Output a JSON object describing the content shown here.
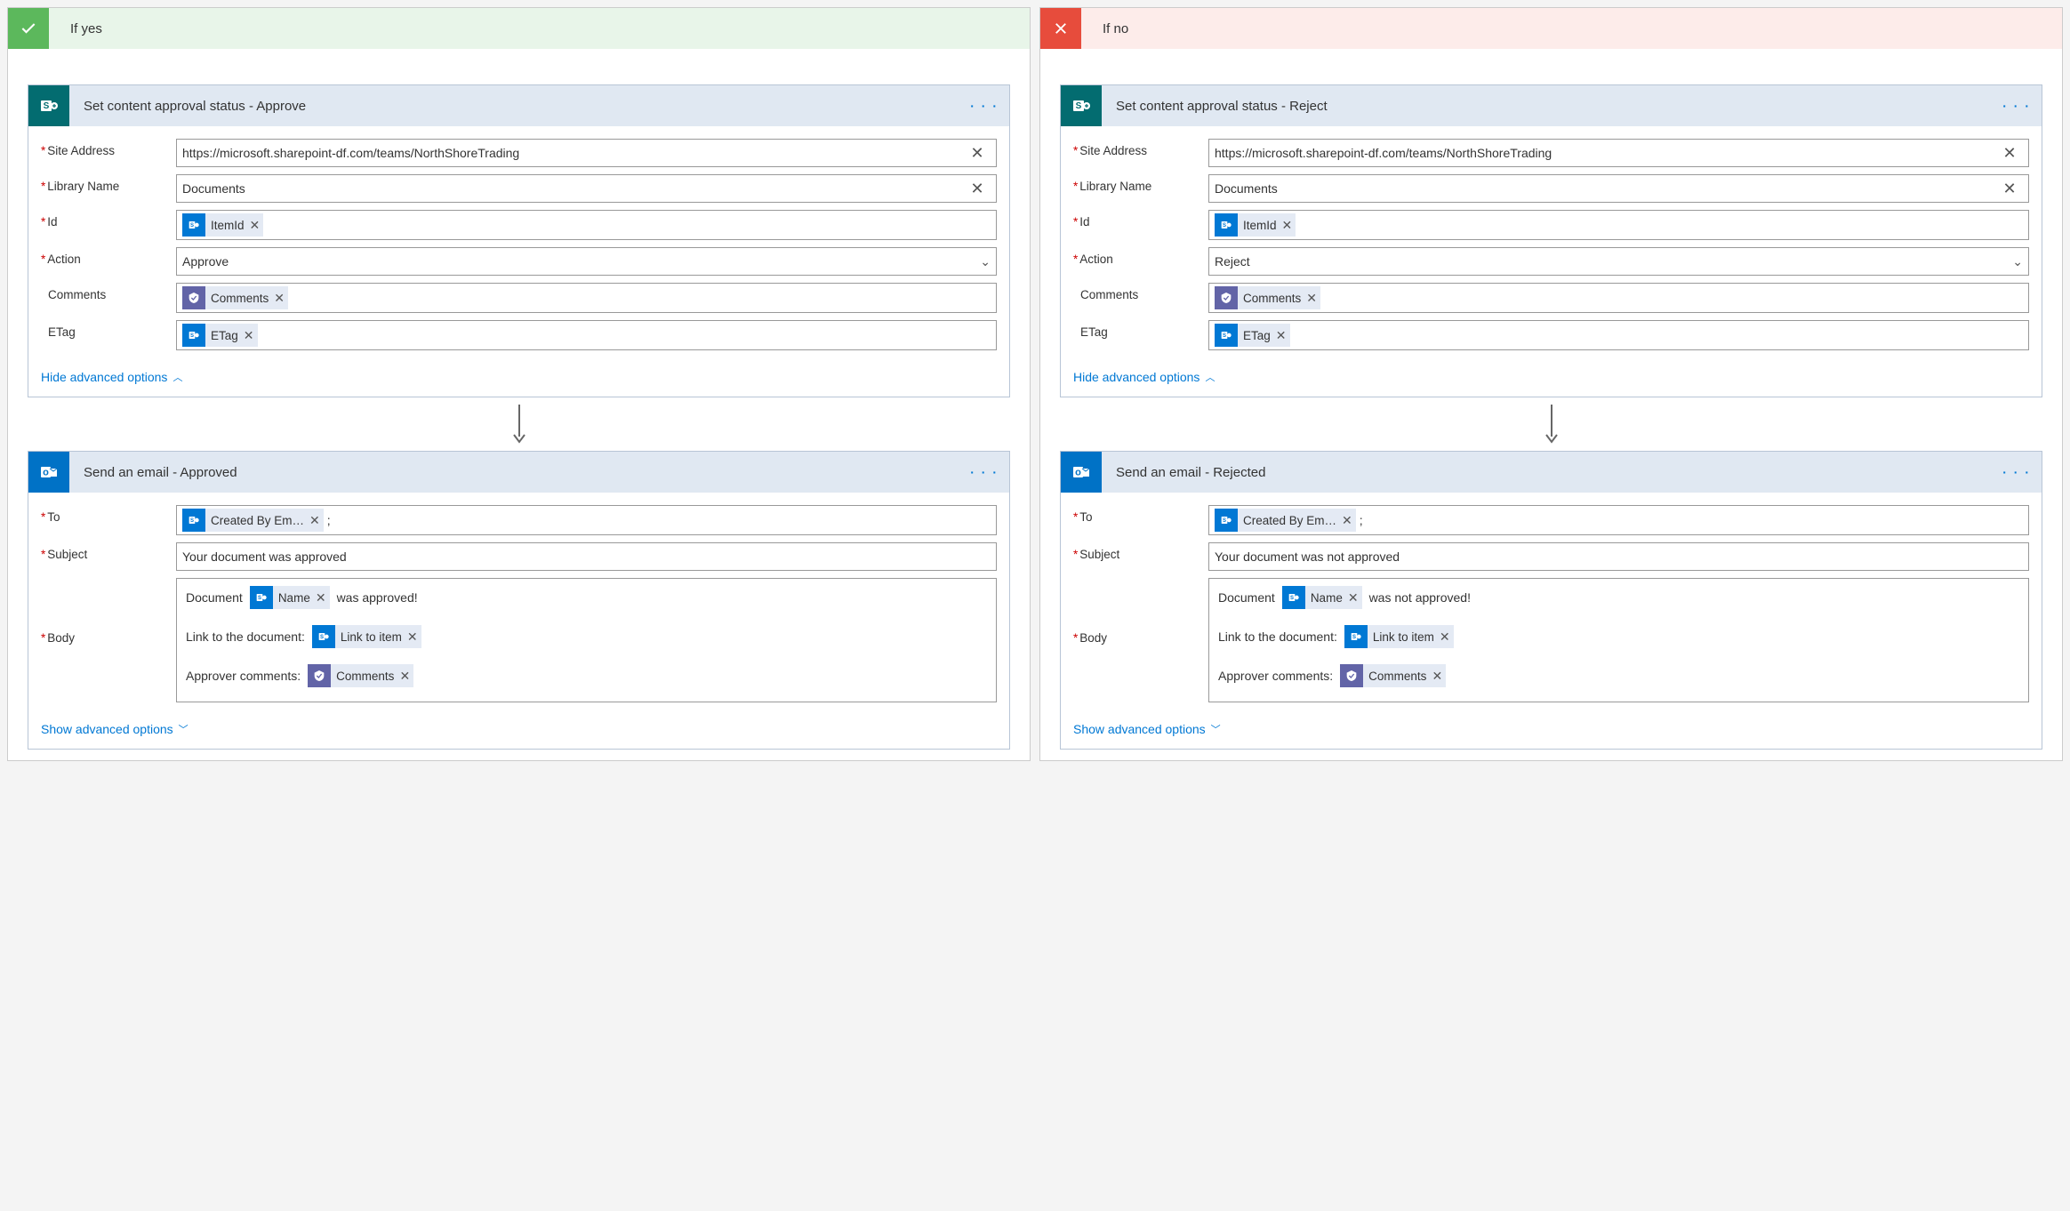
{
  "branches": {
    "yes": {
      "label": "If yes",
      "card1": {
        "title": "Set content approval status - Approve",
        "siteLabel": "Site Address",
        "siteValue": "https://microsoft.sharepoint-df.com/teams/NorthShoreTrading",
        "libLabel": "Library Name",
        "libValue": "Documents",
        "idLabel": "Id",
        "idToken": "ItemId",
        "actionLabel": "Action",
        "actionValue": "Approve",
        "commentsLabel": "Comments",
        "commentsToken": "Comments",
        "etagLabel": "ETag",
        "etagToken": "ETag",
        "advLink": "Hide advanced options"
      },
      "card2": {
        "title": "Send an email - Approved",
        "toLabel": "To",
        "toToken": "Created By Em…",
        "toSuffix": ";",
        "subjectLabel": "Subject",
        "subjectValue": "Your document was approved",
        "bodyLabel": "Body",
        "bodyLine1Before": "Document",
        "bodyLine1Token": "Name",
        "bodyLine1After": "was approved!",
        "bodyLine2Before": "Link to the document:",
        "bodyLine2Token": "Link to item",
        "bodyLine3Before": "Approver comments:",
        "bodyLine3Token": "Comments",
        "advLink": "Show advanced options"
      }
    },
    "no": {
      "label": "If no",
      "card1": {
        "title": "Set content approval status - Reject",
        "siteLabel": "Site Address",
        "siteValue": "https://microsoft.sharepoint-df.com/teams/NorthShoreTrading",
        "libLabel": "Library Name",
        "libValue": "Documents",
        "idLabel": "Id",
        "idToken": "ItemId",
        "actionLabel": "Action",
        "actionValue": "Reject",
        "commentsLabel": "Comments",
        "commentsToken": "Comments",
        "etagLabel": "ETag",
        "etagToken": "ETag",
        "advLink": "Hide advanced options"
      },
      "card2": {
        "title": "Send an email - Rejected",
        "toLabel": "To",
        "toToken": "Created By Em…",
        "toSuffix": ";",
        "subjectLabel": "Subject",
        "subjectValue": "Your document was not approved",
        "bodyLabel": "Body",
        "bodyLine1Before": "Document",
        "bodyLine1Token": "Name",
        "bodyLine1After": "was not approved!",
        "bodyLine2Before": "Link to the document:",
        "bodyLine2Token": "Link to item",
        "bodyLine3Before": "Approver comments:",
        "bodyLine3Token": "Comments",
        "advLink": "Show advanced options"
      }
    }
  }
}
